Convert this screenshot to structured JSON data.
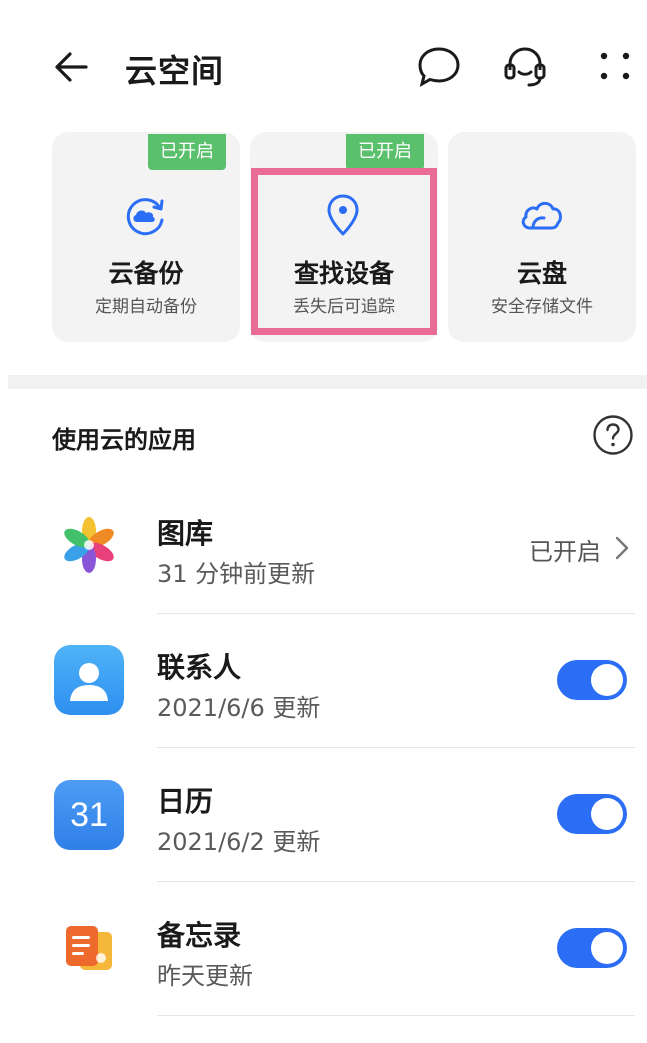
{
  "header": {
    "title": "云空间",
    "back_icon": "arrow-left-icon",
    "chat_icon": "chat-bubble-icon",
    "support_icon": "headset-icon",
    "more_icon": "more-grid-icon"
  },
  "cards": [
    {
      "name": "云备份",
      "desc": "定期自动备份",
      "badge": "已开启",
      "icon": "cloud-sync-icon"
    },
    {
      "name": "查找设备",
      "desc": "丢失后可追踪",
      "badge": "已开启",
      "icon": "location-pin-icon",
      "highlighted": true
    },
    {
      "name": "云盘",
      "desc": "安全存储文件",
      "badge": "",
      "icon": "cloud-icon"
    }
  ],
  "section": {
    "title": "使用云的应用",
    "help_icon": "help-circle-icon"
  },
  "apps": [
    {
      "name": "图库",
      "sub": "31 分钟前更新",
      "status": "已开启",
      "icon": "gallery-flower-icon"
    },
    {
      "name": "联系人",
      "sub": "2021/6/6 更新",
      "toggle": true,
      "icon": "contacts-person-icon"
    },
    {
      "name": "日历",
      "sub": "2021/6/2 更新",
      "toggle": true,
      "icon_text": "31",
      "icon": "calendar-icon"
    },
    {
      "name": "备忘录",
      "sub": "昨天更新",
      "toggle": true,
      "icon": "notes-icon"
    }
  ],
  "colors": {
    "badge_green": "#5bc06c",
    "accent_blue": "#2b6ef5",
    "highlight_pink": "#e86c96"
  }
}
